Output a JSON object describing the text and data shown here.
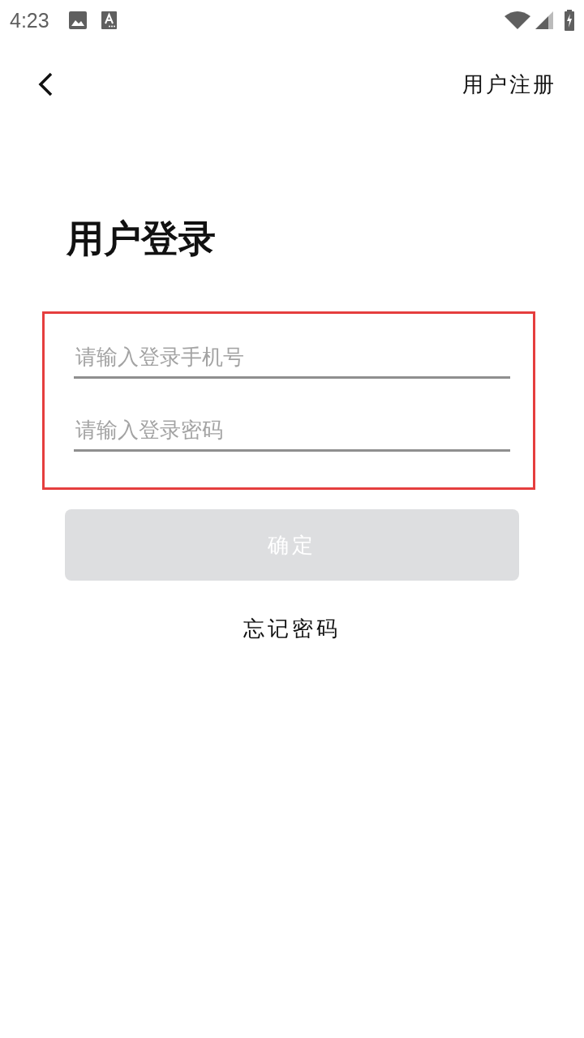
{
  "status_bar": {
    "time": "4:23"
  },
  "top_bar": {
    "action": "用户注册"
  },
  "title": "用户登录",
  "form": {
    "highlighted": true,
    "fields": [
      {
        "placeholder": "请输入登录手机号"
      },
      {
        "placeholder": "请输入登录密码"
      }
    ]
  },
  "submit": {
    "label": "确定",
    "disabled": true
  },
  "forgot_link": "忘记密码"
}
